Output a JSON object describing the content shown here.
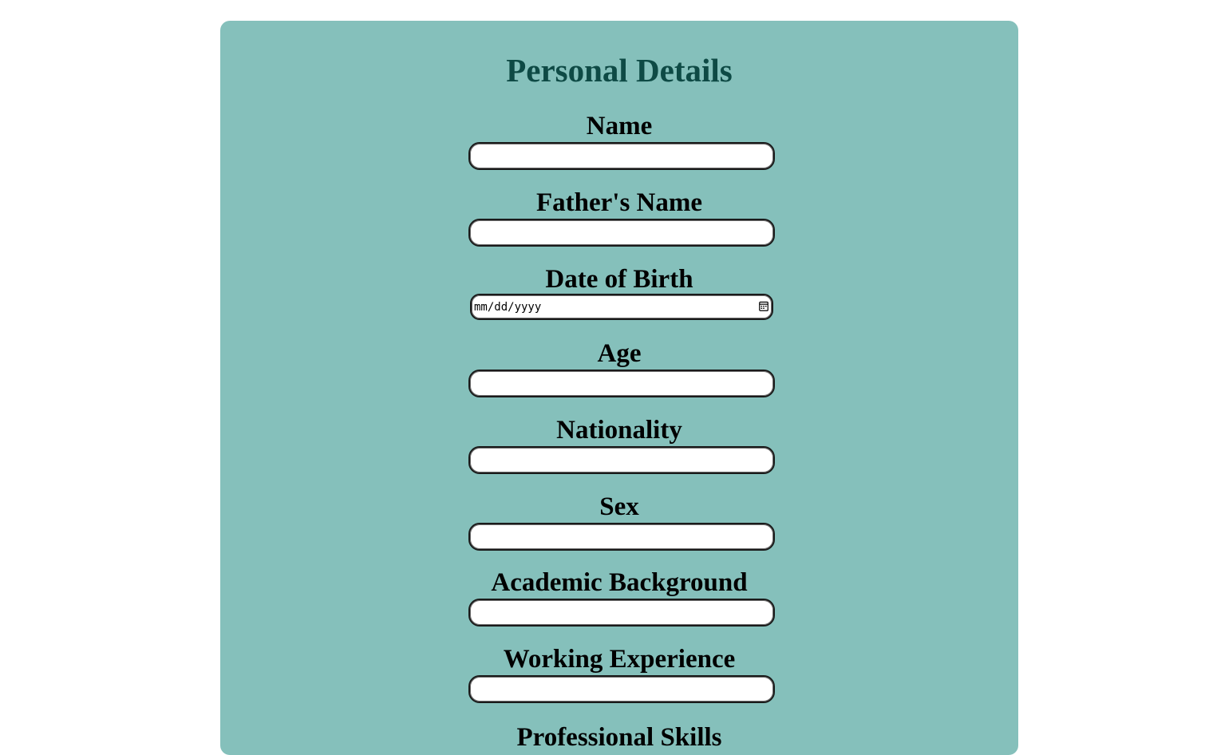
{
  "form": {
    "title": "Personal Details",
    "fields": [
      {
        "label": "Name",
        "value": ""
      },
      {
        "label": "Father's Name",
        "value": ""
      },
      {
        "label": "Date of Birth",
        "placeholder": "mm/dd/yyyy"
      },
      {
        "label": "Age",
        "value": ""
      },
      {
        "label": "Nationality",
        "value": ""
      },
      {
        "label": "Sex",
        "value": ""
      },
      {
        "label": "Academic Background",
        "value": ""
      },
      {
        "label": "Working Experience",
        "value": ""
      },
      {
        "label": "Professional Skills"
      }
    ]
  },
  "colors": {
    "card_background": "#85c0bb",
    "title_color": "#0e4a45",
    "page_background": "#ffffff"
  },
  "icons": {
    "date_picker": "calendar-icon"
  }
}
